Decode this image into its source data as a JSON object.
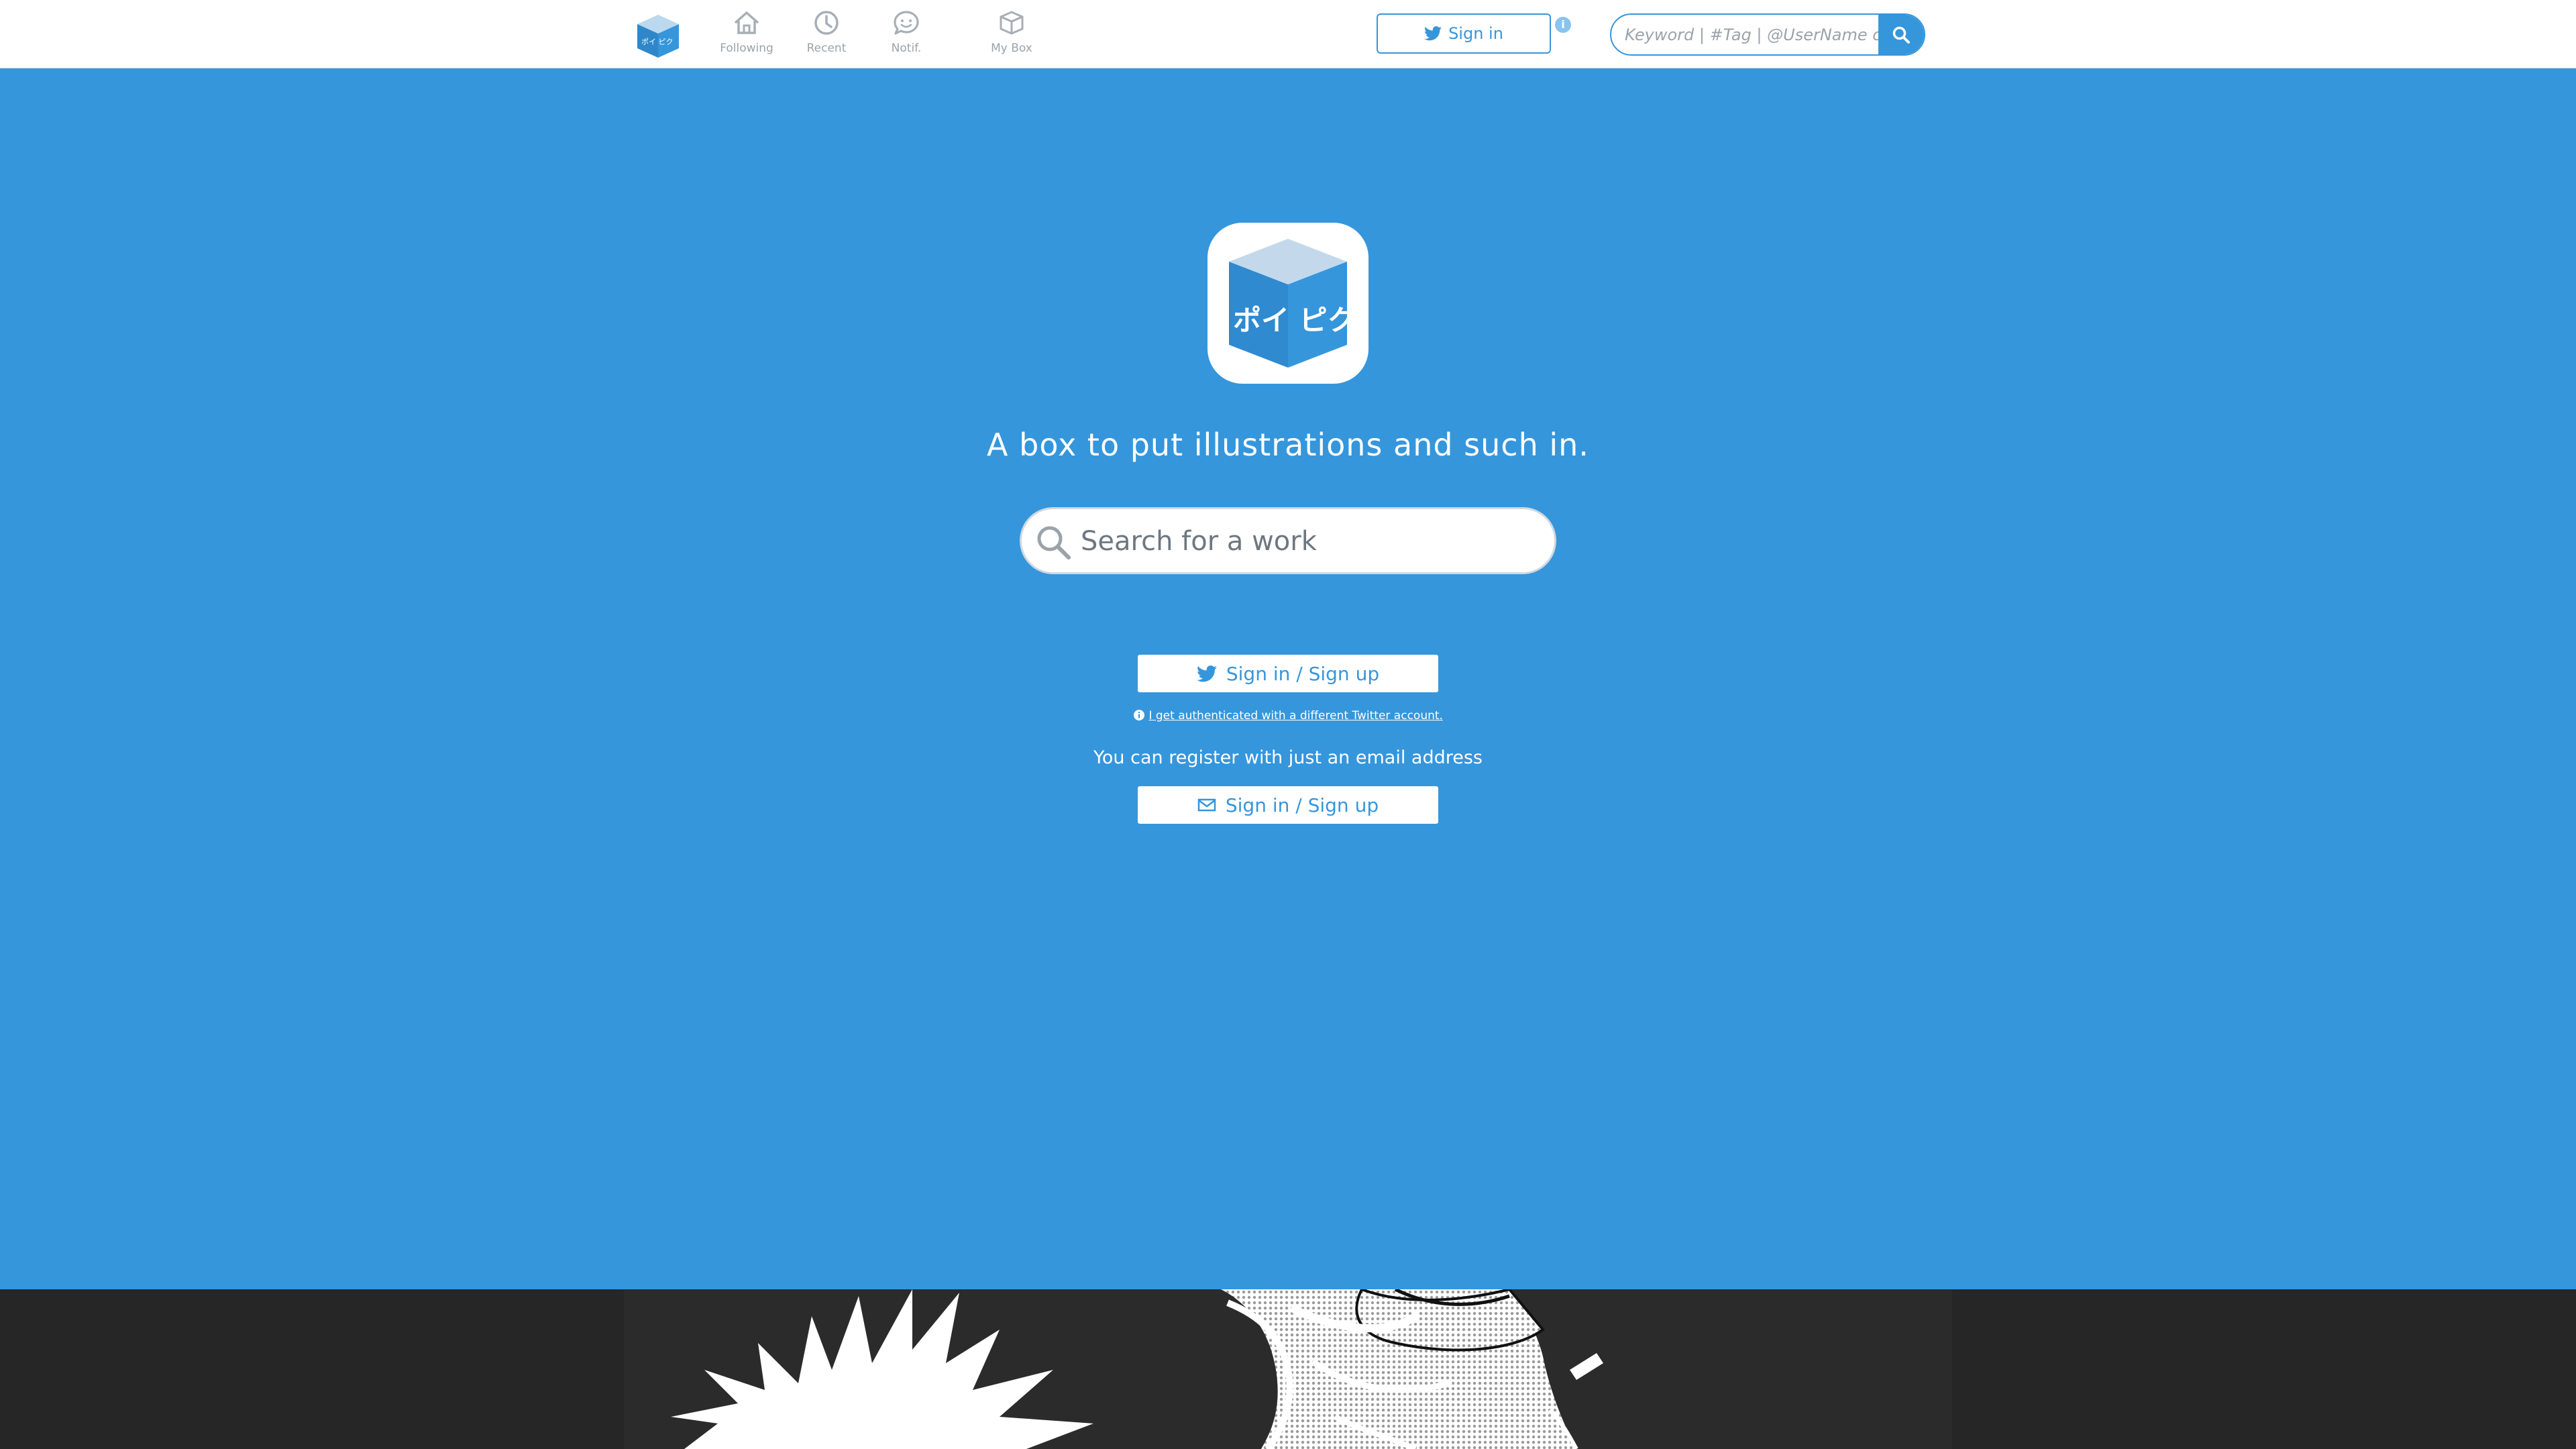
{
  "header": {
    "nav": [
      {
        "label": "Following",
        "icon": "home-icon"
      },
      {
        "label": "Recent",
        "icon": "clock-icon"
      },
      {
        "label": "Notif.",
        "icon": "chat-smile-icon"
      },
      {
        "label": "My Box",
        "icon": "box-icon"
      }
    ],
    "signin_label": "Sign in",
    "info_glyph": "i",
    "search_placeholder": "Keyword | #Tag | @UserName or ID"
  },
  "hero": {
    "logo_text": "ポイ ピク",
    "tagline": "A box to put illustrations and such in.",
    "search_placeholder": "Search for a work"
  },
  "auth": {
    "twitter_label": "Sign in / Sign up",
    "twitter_note": "I get authenticated with a different Twitter account.",
    "email_note": "You can register with just an email address",
    "email_label": "Sign in / Sign up"
  },
  "colors": {
    "brand": "#3596dc",
    "header_bg": "#ffffff",
    "footer_bg": "#262626"
  }
}
